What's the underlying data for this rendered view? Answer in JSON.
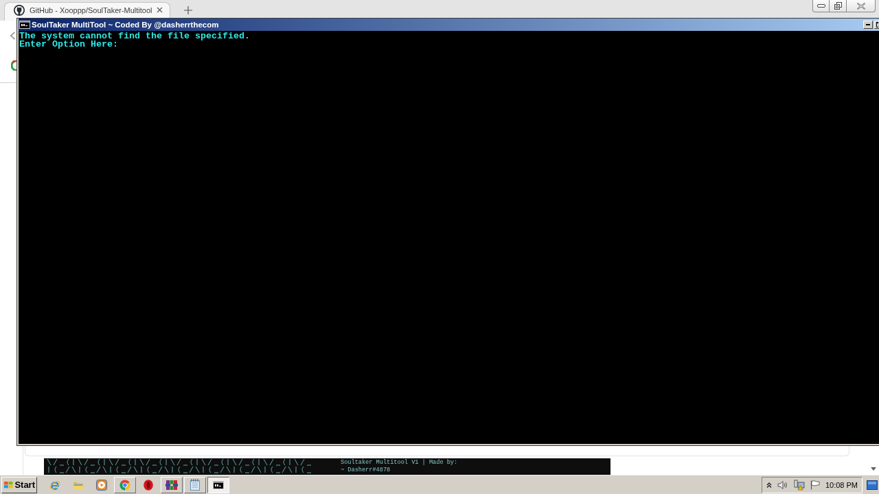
{
  "browser": {
    "tabs": [
      {
        "title": "GitHub - Xooppp/SoulTaker-Multitool",
        "selected": true
      }
    ],
    "readme_image": {
      "lines": [
        "Soultaker Multitool V1 | Made by:",
        "~ Dasherr#4878"
      ]
    }
  },
  "console": {
    "title": "SoulTaker MultiTool ~ Coded By @dasherrthecom",
    "lines": [
      "The system cannot find the file specified.",
      "Enter Option Here:"
    ]
  },
  "taskbar": {
    "start": "Start",
    "apps": [
      {
        "kind": "ie",
        "running": false,
        "selected": false
      },
      {
        "kind": "explorer",
        "running": false,
        "selected": false
      },
      {
        "kind": "media",
        "running": false,
        "selected": false
      },
      {
        "kind": "chrome",
        "running": true,
        "selected": false
      },
      {
        "kind": "opera",
        "running": false,
        "selected": false
      },
      {
        "kind": "winrar",
        "running": true,
        "selected": false
      },
      {
        "kind": "notepad",
        "running": true,
        "selected": false
      },
      {
        "kind": "console",
        "running": true,
        "selected": true
      }
    ],
    "clock": "10:08 PM"
  }
}
